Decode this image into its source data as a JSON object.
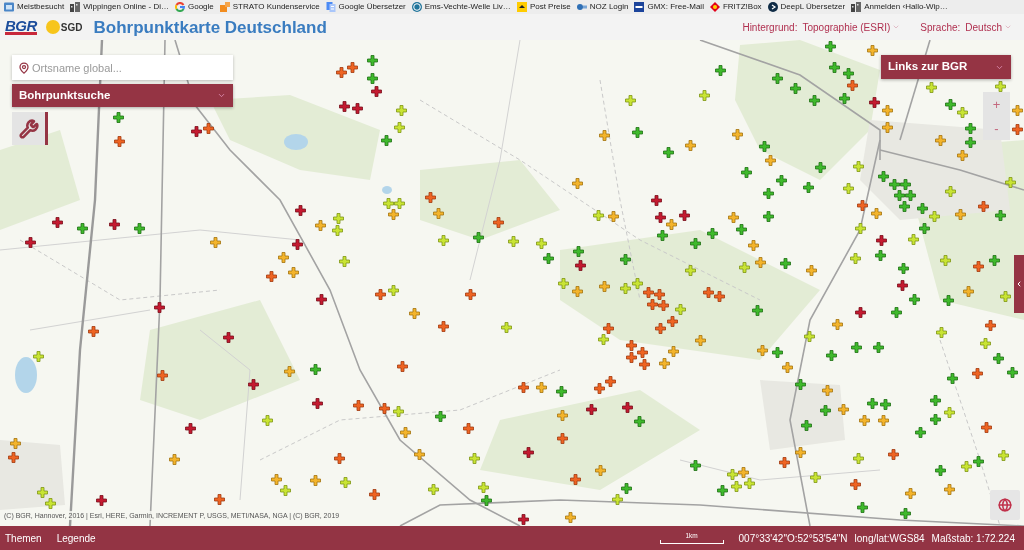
{
  "bookmarks_bar": {
    "items": [
      {
        "label": "Meistbesucht"
      },
      {
        "label": "Wippingen Online - Di…"
      },
      {
        "label": "Google"
      },
      {
        "label": "STRATO Kundenservice"
      },
      {
        "label": "Google Übersetzer"
      },
      {
        "label": "Ems-Vechte-Welle Liv…"
      },
      {
        "label": "Post Preise"
      },
      {
        "label": "NOZ Login"
      },
      {
        "label": "GMX: Free-Mail"
      },
      {
        "label": "FRITZ!Box"
      },
      {
        "label": "DeepL Übersetzer"
      },
      {
        "label": "Anmelden ‹Hallo-Wip…"
      }
    ]
  },
  "header": {
    "logo_bgr": "BGR",
    "logo_sgd": "SGD",
    "title": "Bohrpunktkarte Deutschland",
    "background": {
      "label": "Hintergrund:",
      "value": "Topographie (ESRI)"
    },
    "language": {
      "label": "Sprache:",
      "value": "Deutsch"
    }
  },
  "search": {
    "placeholder": "Ortsname global..."
  },
  "borehole_search": {
    "label": "Bohrpunktsuche"
  },
  "links_menu": {
    "label": "Links zur BGR"
  },
  "zoom": {
    "in": "+",
    "out": "-"
  },
  "attribution": "(C) BGR, Hannover, 2016 | Esri, HERE, Garmin, INCREMENT P, USGS, METI/NASA, NGA | (C) BGR, 2019",
  "status_bar": {
    "tabs": [
      {
        "label": "Themen"
      },
      {
        "label": "Legende"
      }
    ],
    "scale": "1km",
    "coordinates": "007°33'42\"O:52°53'54\"N",
    "projection": "long/lat:WGS84",
    "scale_ratio": "Maßstab: 1:72.224"
  }
}
